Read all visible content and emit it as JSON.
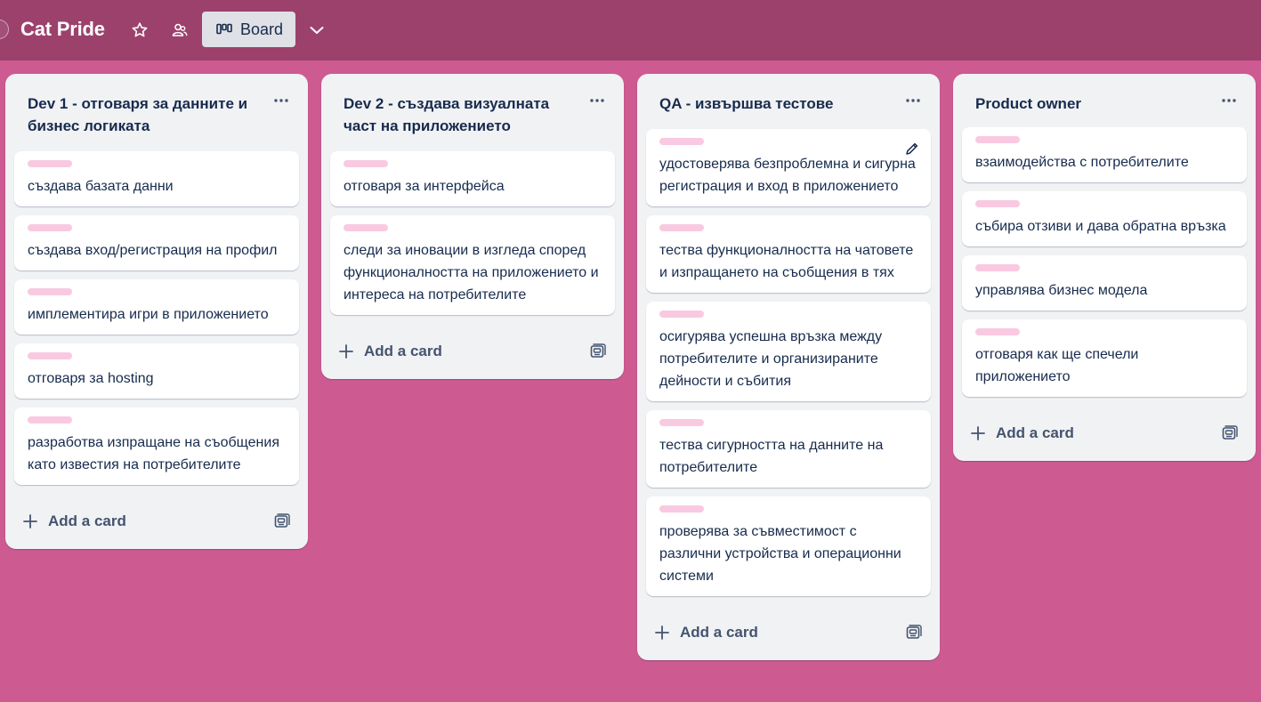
{
  "header": {
    "board_title": "Cat Pride",
    "view_label": "Board",
    "icons": [
      "star-icon",
      "workspace-visibility-icon",
      "board-view-icon",
      "chevron-down-icon"
    ]
  },
  "colors": {
    "background": "#cd5a91",
    "topbar": "#9c416c",
    "label": "#f9c9e1"
  },
  "lists": [
    {
      "title": "Dev 1 - отговаря за данните и бизнес логиката",
      "cards": [
        "създава базата данни",
        "създава вход/регистрация на профил",
        "имплементира игри в приложението",
        "отговаря за hosting",
        "разработва изпращане на съобщения като известия на потребителите"
      ],
      "add_card": "Add a card"
    },
    {
      "title": "Dev 2 - създава визуалната част на приложението",
      "cards": [
        "отговаря за интерфейса",
        "следи за иновации в изгледа според функционалността на приложението и интереса на потребителите"
      ],
      "add_card": "Add a card"
    },
    {
      "title": "QA - извършва тестове",
      "cards": [
        "удостоверява безпроблемна и сигурна регистрация и вход в приложението",
        "тества функционалността на чатовете и изпращането на съобщения в тях",
        "осигурява успешна връзка между потребителите и организираните дейности и събития",
        "тества сигурността на данните на потребителите",
        "проверява за съвместимост с различни устройства и операционни системи"
      ],
      "add_card": "Add a card"
    },
    {
      "title": "Product owner",
      "cards": [
        "взаимодейства с потребителите",
        "събира отзиви и дава обратна връзка",
        "управлява бизнес модела",
        "отговаря как ще спечели приложението"
      ],
      "add_card": "Add a card"
    }
  ]
}
